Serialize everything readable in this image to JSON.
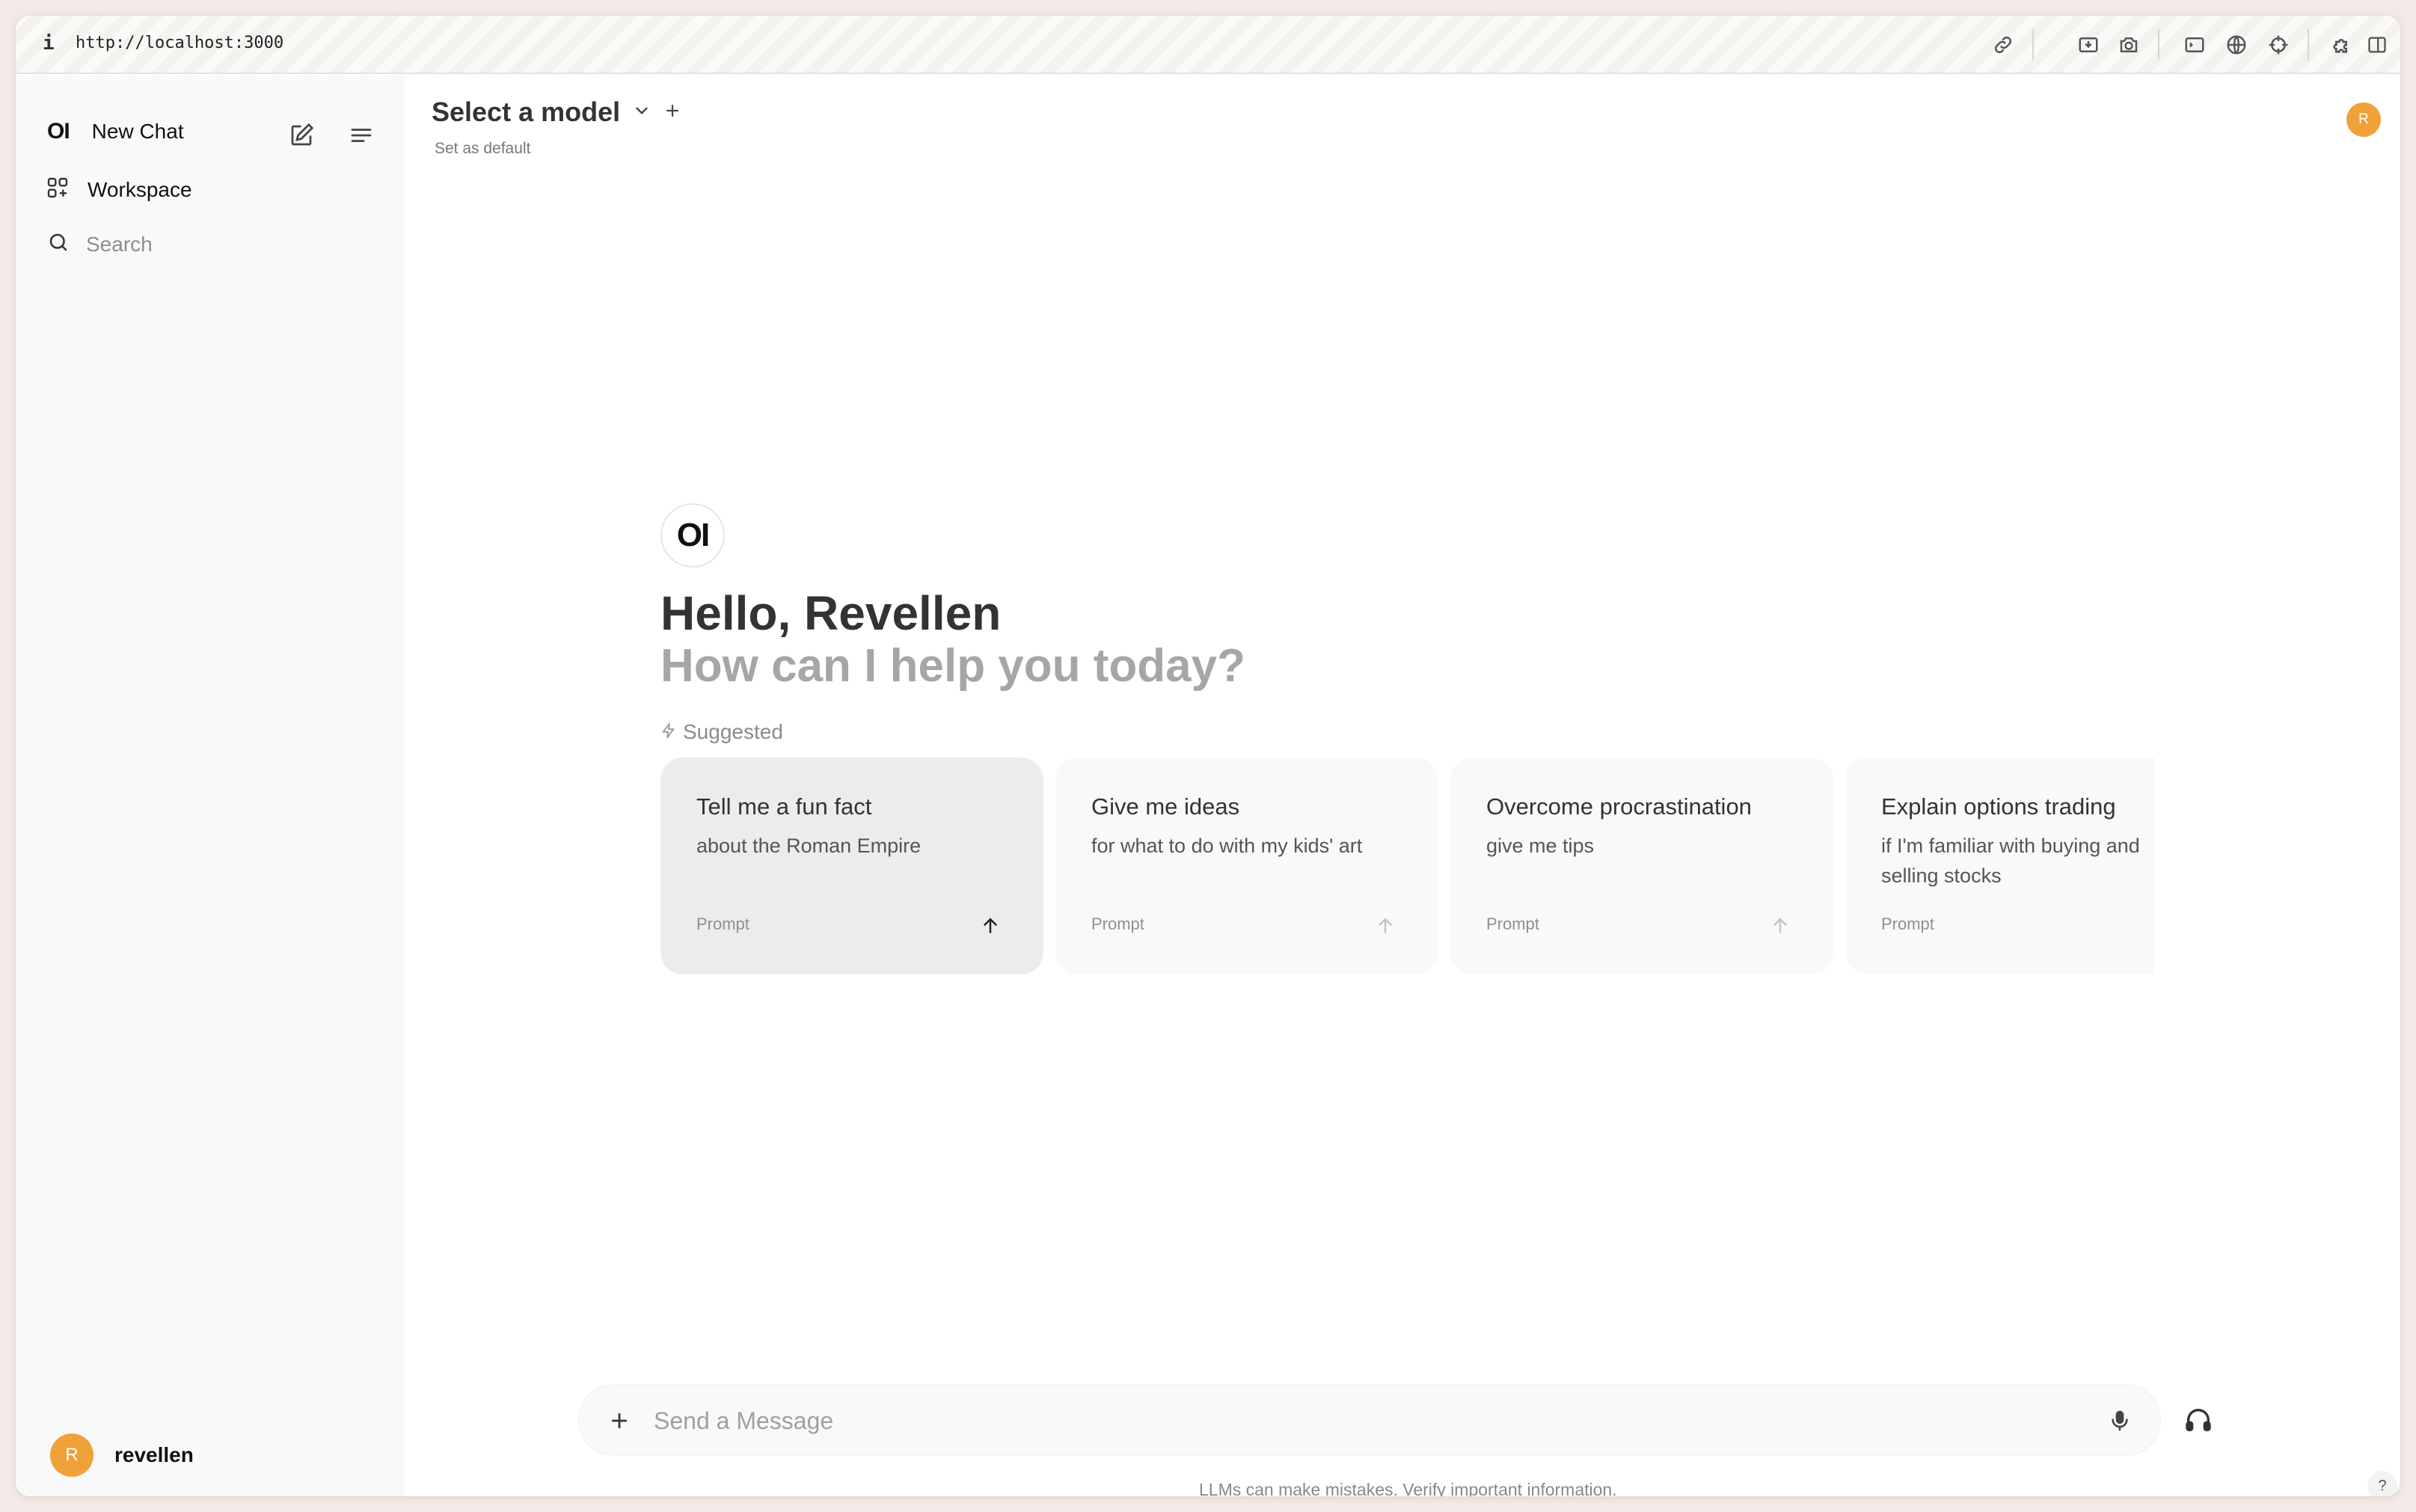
{
  "browser": {
    "info_glyph": "i",
    "url": "http://localhost:3000",
    "toolbar_icons": [
      "link-icon",
      "download-box-icon",
      "camera-icon",
      "terminal-icon",
      "globe-icon",
      "crosshair-icon",
      "puzzle-icon",
      "split-view-icon"
    ]
  },
  "sidebar": {
    "logo": "OI",
    "new_chat": "New Chat",
    "workspace": "Workspace",
    "search_placeholder": "Search",
    "user": {
      "initial": "R",
      "name": "revellen"
    }
  },
  "header": {
    "model_select": "Select a model",
    "set_default": "Set as default",
    "avatar_initial": "R"
  },
  "hero": {
    "logo": "OI",
    "greeting": "Hello, Revellen",
    "subtitle": "How can I help you today?",
    "suggested_label": "Suggested"
  },
  "suggestions": [
    {
      "title": "Tell me a fun fact",
      "subtitle": "about the Roman Empire",
      "tag": "Prompt"
    },
    {
      "title": "Give me ideas",
      "subtitle": "for what to do with my kids' art",
      "tag": "Prompt"
    },
    {
      "title": "Overcome procrastination",
      "subtitle": "give me tips",
      "tag": "Prompt"
    },
    {
      "title": "Explain options trading",
      "subtitle": "if I'm familiar with buying and selling stocks",
      "tag": "Prompt"
    }
  ],
  "composer": {
    "placeholder": "Send a Message",
    "disclaimer": "LLMs can make mistakes. Verify important information.",
    "help": "?"
  },
  "colors": {
    "avatar": "#f0a13a",
    "sidebar_bg": "#f9f9f9",
    "card_active_bg": "#ececec",
    "muted_text": "#a6a6a6"
  }
}
